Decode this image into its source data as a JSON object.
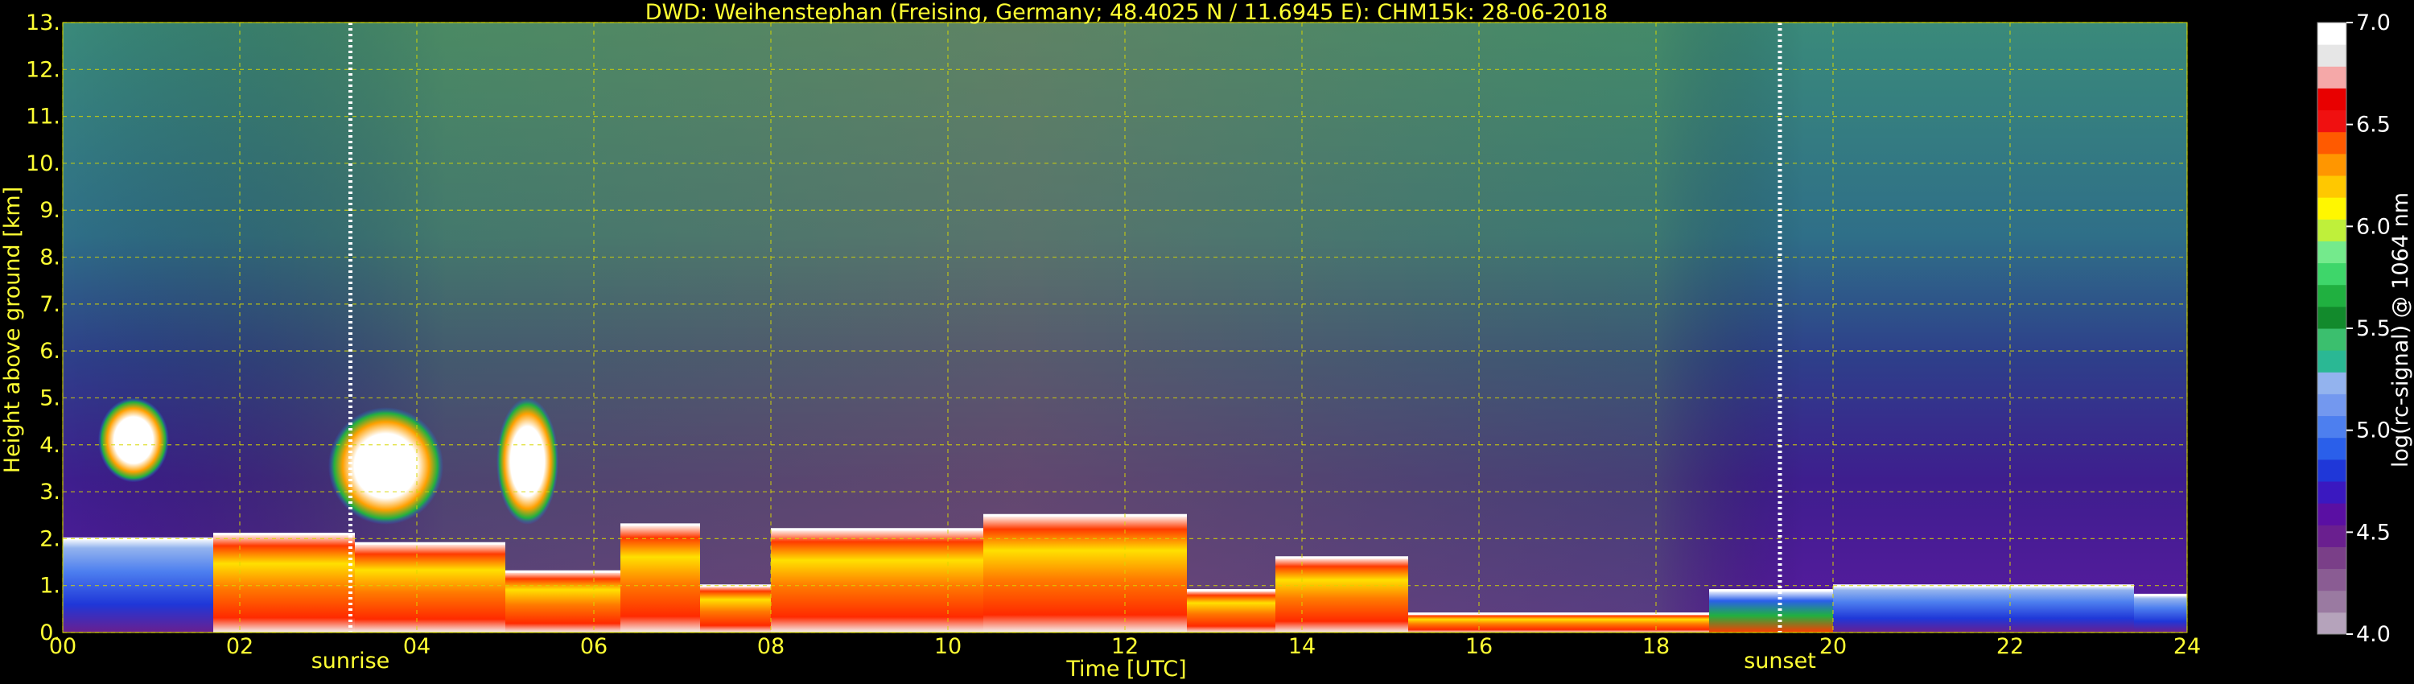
{
  "chart_data": {
    "type": "heatmap",
    "title": "DWD: Weihenstephan (Freising, Germany; 48.4025 N / 11.6945 E):    CHM15k: 28-06-2018",
    "xlabel": "Time [UTC]",
    "ylabel": "Height above ground [km]",
    "xlim": [
      0,
      24
    ],
    "ylim": [
      0.0,
      13.0
    ],
    "x_ticks": [
      {
        "value": 0,
        "label": "00"
      },
      {
        "value": 2,
        "label": "02"
      },
      {
        "value": 4,
        "label": "04"
      },
      {
        "value": 6,
        "label": "06"
      },
      {
        "value": 8,
        "label": "08"
      },
      {
        "value": 10,
        "label": "10"
      },
      {
        "value": 12,
        "label": "12"
      },
      {
        "value": 14,
        "label": "14"
      },
      {
        "value": 16,
        "label": "16"
      },
      {
        "value": 18,
        "label": "18"
      },
      {
        "value": 20,
        "label": "20"
      },
      {
        "value": 22,
        "label": "22"
      },
      {
        "value": 24,
        "label": "24"
      }
    ],
    "y_ticks": [
      {
        "value": 0,
        "label": "0."
      },
      {
        "value": 1,
        "label": "1."
      },
      {
        "value": 2,
        "label": "2."
      },
      {
        "value": 3,
        "label": "3."
      },
      {
        "value": 4,
        "label": "4."
      },
      {
        "value": 5,
        "label": "5."
      },
      {
        "value": 6,
        "label": "6."
      },
      {
        "value": 7,
        "label": "7."
      },
      {
        "value": 8,
        "label": "8."
      },
      {
        "value": 9,
        "label": "9."
      },
      {
        "value": 10,
        "label": "10."
      },
      {
        "value": 11,
        "label": "11."
      },
      {
        "value": 12,
        "label": "12."
      },
      {
        "value": 13,
        "label": "13."
      }
    ],
    "grid": true,
    "annotations": [
      {
        "label": "sunrise",
        "time": 3.25
      },
      {
        "label": "sunset",
        "time": 19.4
      }
    ],
    "colorbar": {
      "label": "log(rc-signal) @ 1064 nm",
      "range": [
        4.0,
        7.0
      ],
      "ticks": [
        "4.0",
        "4.5",
        "5.0",
        "5.5",
        "6.0",
        "6.5",
        "7.0"
      ],
      "colors": [
        "#b5a3bb",
        "#9a7aa1",
        "#8a5c93",
        "#7a3f88",
        "#6a1f8f",
        "#5a0fa3",
        "#3a18c0",
        "#1f37d8",
        "#2a5fea",
        "#4d7fef",
        "#7398ef",
        "#93b3ee",
        "#2ab894",
        "#3bbf6e",
        "#128a2c",
        "#20b040",
        "#3ed66a",
        "#74ea8c",
        "#bff03a",
        "#fff700",
        "#ffc800",
        "#ff9600",
        "#ff5a00",
        "#f01010",
        "#e80000",
        "#f5a8a8",
        "#e6e6e6",
        "#ffffff"
      ]
    },
    "grid_color": "#d8d800",
    "label_color": "#ffff33",
    "regions": [
      {
        "t0": 0.0,
        "t1": 1.7,
        "base": 0.0,
        "top": 2.0,
        "level": "low"
      },
      {
        "t0": 1.7,
        "t1": 3.3,
        "base": 0.0,
        "top": 2.1,
        "level": "high"
      },
      {
        "t0": 3.3,
        "t1": 5.0,
        "base": 0.0,
        "top": 1.9,
        "level": "high"
      },
      {
        "t0": 5.0,
        "t1": 6.3,
        "base": 0.0,
        "top": 1.3,
        "level": "high"
      },
      {
        "t0": 6.3,
        "t1": 7.2,
        "base": 0.0,
        "top": 2.3,
        "level": "high"
      },
      {
        "t0": 7.2,
        "t1": 8.0,
        "base": 0.0,
        "top": 1.0,
        "level": "high"
      },
      {
        "t0": 8.0,
        "t1": 10.4,
        "base": 0.0,
        "top": 2.2,
        "level": "high"
      },
      {
        "t0": 10.4,
        "t1": 12.7,
        "base": 0.0,
        "top": 2.5,
        "level": "high"
      },
      {
        "t0": 12.7,
        "t1": 13.7,
        "base": 0.0,
        "top": 0.9,
        "level": "high"
      },
      {
        "t0": 13.7,
        "t1": 15.2,
        "base": 0.0,
        "top": 1.6,
        "level": "high"
      },
      {
        "t0": 15.2,
        "t1": 18.6,
        "base": 0.0,
        "top": 0.4,
        "level": "high"
      },
      {
        "t0": 18.6,
        "t1": 20.0,
        "base": 0.0,
        "top": 0.9,
        "level": "mid"
      },
      {
        "t0": 20.0,
        "t1": 23.4,
        "base": 0.0,
        "top": 1.0,
        "level": "low"
      },
      {
        "t0": 23.4,
        "t1": 24.0,
        "base": 0.0,
        "top": 0.8,
        "level": "low"
      },
      {
        "t0": 0.4,
        "t1": 1.2,
        "base": 3.2,
        "top": 5.0,
        "level": "cloud"
      },
      {
        "t0": 3.0,
        "t1": 4.3,
        "base": 2.3,
        "top": 4.8,
        "level": "cloud"
      },
      {
        "t0": 4.9,
        "t1": 5.6,
        "base": 2.3,
        "top": 5.0,
        "level": "cloud"
      }
    ]
  }
}
